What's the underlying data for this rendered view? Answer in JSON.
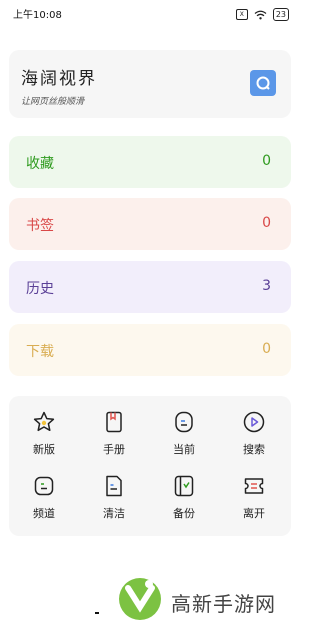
{
  "status_bar": {
    "time": "上午10:08",
    "sim_label": "X",
    "battery": "23"
  },
  "header": {
    "title": "海阔视界",
    "subtitle": "让网页丝般顺滑",
    "search_icon": "search-icon",
    "accent_color": "#5b97e8"
  },
  "stats": [
    {
      "label": "收藏",
      "count": "0",
      "color": "#2f9b1f"
    },
    {
      "label": "书签",
      "count": "0",
      "color": "#d94848"
    },
    {
      "label": "历史",
      "count": "3",
      "color": "#5a3f96"
    },
    {
      "label": "下载",
      "count": "0",
      "color": "#d9ad52"
    }
  ],
  "grid": [
    {
      "label": "新版",
      "icon": "star-icon"
    },
    {
      "label": "手册",
      "icon": "bookmark-book-icon"
    },
    {
      "label": "当前",
      "icon": "current-page-icon"
    },
    {
      "label": "搜索",
      "icon": "play-search-icon"
    },
    {
      "label": "频道",
      "icon": "channel-icon"
    },
    {
      "label": "清洁",
      "icon": "clean-icon"
    },
    {
      "label": "备份",
      "icon": "backup-icon"
    },
    {
      "label": "离开",
      "icon": "ticket-exit-icon"
    }
  ],
  "watermark": {
    "text": "高新手游网"
  }
}
